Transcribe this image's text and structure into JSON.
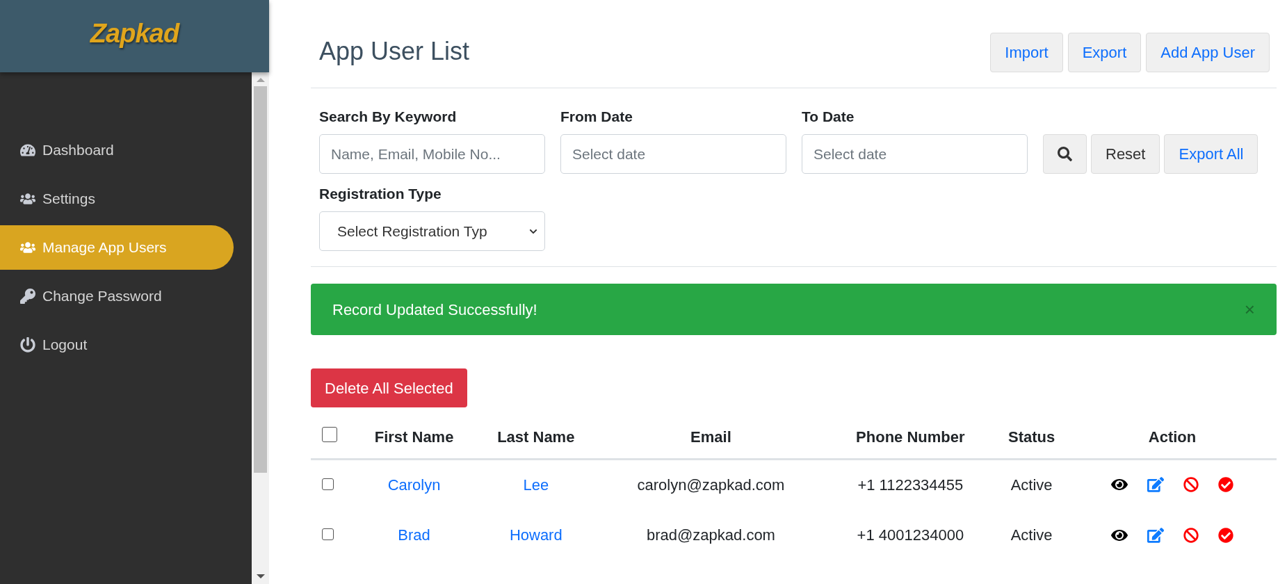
{
  "sidebar": {
    "logo": "Zapkad",
    "items": [
      {
        "label": "Dashboard",
        "kind": "dashboard",
        "selected": false
      },
      {
        "label": "Settings",
        "kind": "users",
        "selected": false
      },
      {
        "label": "Manage App Users",
        "kind": "users",
        "selected": true
      },
      {
        "label": "Change Password",
        "kind": "password",
        "selected": false
      },
      {
        "label": "Logout",
        "kind": "logout",
        "selected": false
      }
    ]
  },
  "page": {
    "title": "App User List",
    "header_buttons": [
      "Import",
      "Export",
      "Add App User"
    ]
  },
  "filters": {
    "keyword": {
      "label": "Search By Keyword",
      "placeholder": "Name, Email, Mobile No..."
    },
    "from_date": {
      "label": "From Date",
      "placeholder": "Select date"
    },
    "to_date": {
      "label": "To Date",
      "placeholder": "Select date"
    },
    "reset_button": "Reset",
    "export_all_button": "Export All",
    "registration_type": {
      "label": "Registration Type",
      "value": "Select Registration Typ"
    }
  },
  "alert": {
    "message": "Record Updated Successfully!",
    "close": "×"
  },
  "delete_button": "Delete All Selected",
  "table": {
    "select_all_checked": false,
    "columns": [
      "First Name",
      "Last Name",
      "Email",
      "Phone Number",
      "Status",
      "Action"
    ],
    "rows": [
      {
        "checked": false,
        "first_name": "Carolyn",
        "last_name": "Lee",
        "email": "carolyn@zapkad.com",
        "phone": "+1 1122334455",
        "status": "Active"
      },
      {
        "checked": false,
        "first_name": "Brad",
        "last_name": "Howard",
        "email": "brad@zapkad.com",
        "phone": "+1 4001234000",
        "status": "Active"
      }
    ]
  }
}
